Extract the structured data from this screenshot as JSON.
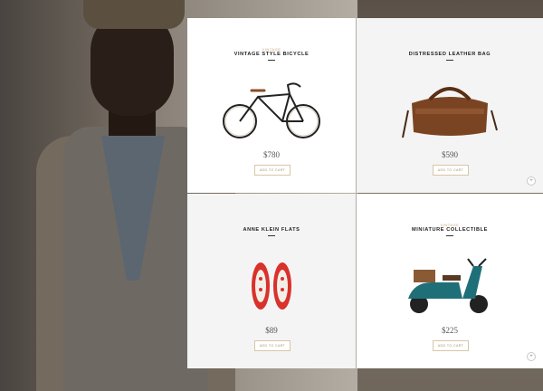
{
  "products": [
    {
      "category": "Vintage",
      "title": "Vintage Style Bicycle",
      "price": "$780",
      "button": "Add to cart"
    },
    {
      "category": "",
      "title": "Distressed Leather Bag",
      "price": "$590",
      "button": "Add to cart"
    },
    {
      "category": "",
      "title": "Anne Klein Flats",
      "price": "$89",
      "button": "Add to cart"
    },
    {
      "category": "Vintage",
      "title": "Miniature Collectible",
      "price": "$225",
      "button": "Add to cart"
    }
  ],
  "icons": {
    "plus": "+"
  }
}
